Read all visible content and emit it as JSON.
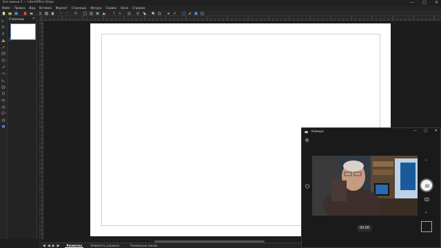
{
  "window": {
    "title": "Без имени 1 — LibreOffice Draw",
    "controls": [
      "—",
      "□",
      "✕"
    ]
  },
  "menubar": {
    "items": [
      "Файл",
      "Правка",
      "Вид",
      "Вставка",
      "Формат",
      "Страница",
      "Фигура",
      "Сервис",
      "Окно",
      "Справка"
    ]
  },
  "pages_panel": {
    "title": "Страницы",
    "close": "×",
    "thumb_number": "1"
  },
  "bottom_tabs": {
    "nav": [
      "◀",
      "◀",
      "▶",
      "▶"
    ],
    "tabs": [
      "Разметка",
      "Элементы управле...",
      "Размерные линии"
    ],
    "active_index": 0
  },
  "camera": {
    "title": "Камера",
    "controls": [
      "—",
      "□",
      "✕"
    ],
    "timer": "00:00",
    "chevron_up": "⌃",
    "chevron_down": "⌄"
  },
  "colors": {
    "accent": "#5a8ad6",
    "page": "#ffffff",
    "background": "#1e1e1e"
  }
}
